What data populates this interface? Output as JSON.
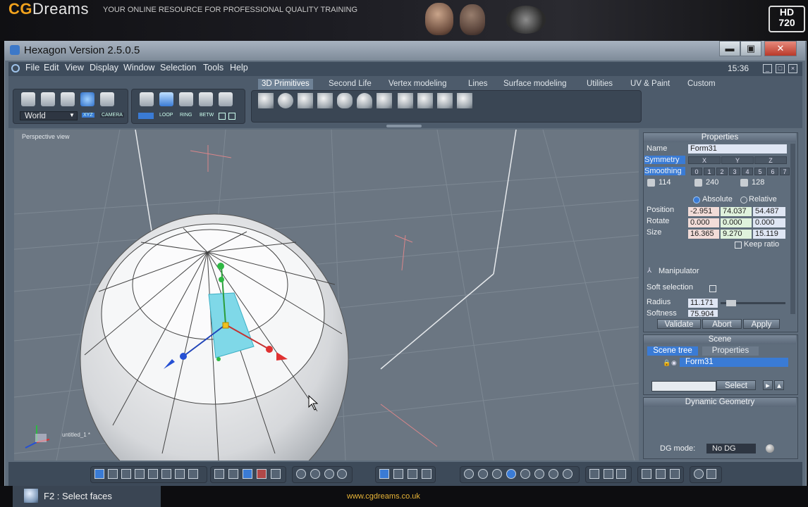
{
  "banner": {
    "brand_prefix": "CG",
    "brand_suffix": "Dreams",
    "tagline": "YOUR ONLINE RESOURCE FOR PROFESSIONAL QUALITY TRAINING",
    "hd_line1": "HD",
    "hd_line2": "720"
  },
  "window": {
    "title": "Hexagon Version 2.5.0.5",
    "min_label": "▬",
    "max_label": "▣",
    "close_label": "✕"
  },
  "menu": {
    "items": [
      "File",
      "Edit",
      "View",
      "Display",
      "Window",
      "Selection",
      "Tools",
      "Help"
    ],
    "clock": "15:36"
  },
  "toolbar": {
    "coord_space": "World",
    "xyz_label": "XYZ",
    "camera_label": "CAMERA",
    "edge_labels": [
      "LOOP",
      "RING",
      "BETW"
    ],
    "tabs": [
      "3D Primitives",
      "Second Life",
      "Vertex modeling",
      "Lines",
      "Surface modeling",
      "Utilities",
      "UV & Paint",
      "Custom"
    ],
    "active_tab": "3D Primitives"
  },
  "viewport": {
    "label": "Perspective view",
    "object_label": "untitled_1 *"
  },
  "properties": {
    "header": "Properties",
    "name_label": "Name",
    "name_value": "Form31",
    "symmetry_label": "Symmetry",
    "symmetry_axes": [
      "X",
      "Y",
      "Z"
    ],
    "smoothing_label": "Smoothing",
    "smoothing_levels": [
      "0",
      "1",
      "2",
      "3",
      "4",
      "5",
      "6",
      "7"
    ],
    "stats": [
      "114",
      "240",
      "128"
    ],
    "absolute_label": "Absolute",
    "relative_label": "Relative",
    "position_label": "Position",
    "position": [
      "-2.951",
      "74.037",
      "54.487"
    ],
    "rotate_label": "Rotate",
    "rotate": [
      "0.000",
      "0.000",
      "0.000"
    ],
    "size_label": "Size",
    "size": [
      "16.365",
      "9.270",
      "15.119"
    ],
    "keep_ratio": "Keep ratio",
    "manipulator": "Manipulator",
    "soft_selection": "Soft selection",
    "radius_label": "Radius",
    "radius_value": "11.171",
    "softness_label": "Softness",
    "softness_value": "75.904",
    "validate": "Validate",
    "abort": "Abort",
    "apply": "Apply"
  },
  "scene": {
    "header": "Scene",
    "tab_tree": "Scene tree",
    "tab_props": "Properties",
    "item": "Form31",
    "select_button": "Select"
  },
  "dynamic_geometry": {
    "header": "Dynamic Geometry",
    "mode_label": "DG mode:",
    "mode_value": "No DG"
  },
  "status": {
    "text": "F2 : Select faces",
    "url": "www.cgdreams.co.uk"
  },
  "colors": {
    "accent_blue": "#3a7bd5",
    "selected_face": "#7fd8e8",
    "brand_orange": "#f1a21d"
  }
}
